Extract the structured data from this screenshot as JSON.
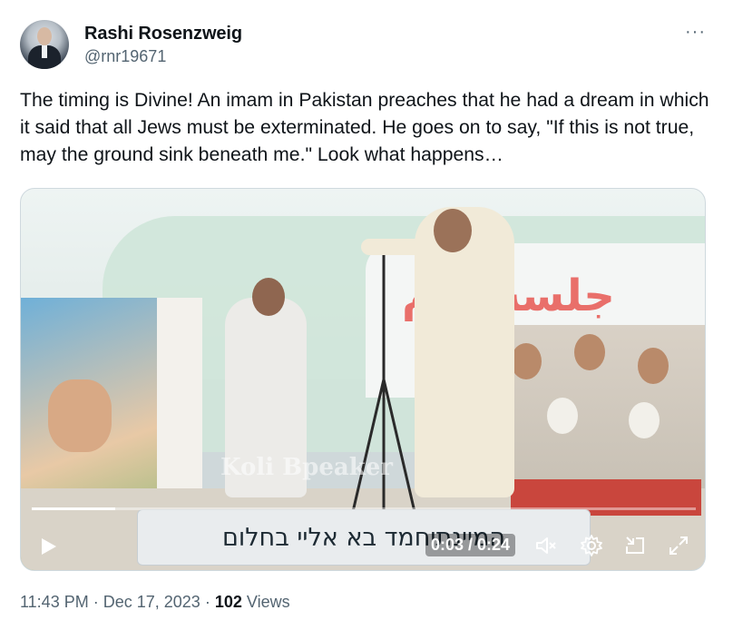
{
  "author": {
    "name": "Rashi Rosenzweig",
    "handle": "@rnr19671",
    "avatar": "avatar-photo"
  },
  "more_label": "···",
  "tweet_text": "The timing is Divine! An imam in Pakistan preaches that he had a dream in which it said that all Jews must be exterminated. He goes on to say, \"If this is not true, may the ground sink beneath me.\" Look what happens…",
  "video": {
    "subtitle": "המיינתיחמד בא אליי בחלום",
    "banner_text": "جلسه عام",
    "watermark": "Koli Bpeaker",
    "time": "0:03 / 0:24",
    "progress": 0.125,
    "icons": [
      "play-icon",
      "mute-icon",
      "settings-icon",
      "pip-icon",
      "fullscreen-icon"
    ]
  },
  "meta": {
    "time": "11:43 PM",
    "date": "Dec 17, 2023",
    "views_count": "102",
    "views_label": "Views"
  },
  "colors": {
    "text": "#0f1419",
    "secondary": "#536471",
    "border": "#cfd9de"
  }
}
